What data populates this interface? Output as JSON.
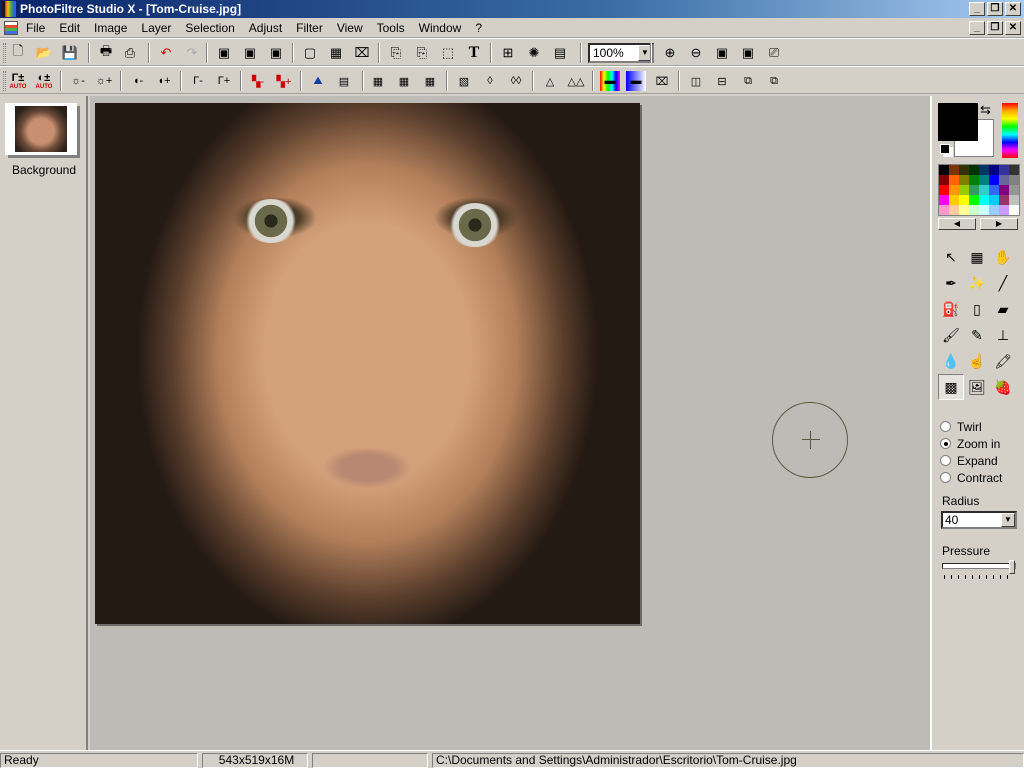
{
  "window": {
    "title": "PhotoFiltre Studio X - [Tom-Cruise.jpg]",
    "controls": {
      "minimize": "_",
      "restore": "❐",
      "close": "✕"
    }
  },
  "menu": [
    "File",
    "Edit",
    "Image",
    "Layer",
    "Selection",
    "Adjust",
    "Filter",
    "View",
    "Tools",
    "Window",
    "?"
  ],
  "toolbar1": {
    "icons": [
      "new-icon",
      "open-icon",
      "save-icon",
      "print-icon",
      "scan-icon",
      "undo-icon",
      "redo-icon",
      "copy-image-icon",
      "paste-image-icon",
      "paste-as-new-icon",
      "flatten-icon",
      "palette-icon",
      "transparency-icon",
      "export-icon",
      "crop-icon",
      "selection-icon",
      "text-icon",
      "explorer-icon",
      "plugins-icon",
      "window-icon",
      "zoom-in-icon",
      "zoom-out-icon",
      "fit-icon",
      "actual-size-icon",
      "slideshow-icon"
    ],
    "zoom_value": "100%",
    "glyphs": {
      "undo": "↶",
      "redo": "↷",
      "text": "T",
      "zoom_in": "⊕",
      "zoom_out": "⊖"
    }
  },
  "toolbar2": {
    "auto_label": "AUTO",
    "icons": [
      "gamma-auto-icon",
      "contrast-auto-icon",
      "brightness-minus-icon",
      "brightness-plus-icon",
      "contrast-minus-icon",
      "contrast-plus-icon",
      "gamma-minus-icon",
      "gamma-plus-icon",
      "saturation-minus-icon",
      "saturation-plus-icon",
      "histogram-icon",
      "color-balance-icon",
      "dust-filter-icon",
      "grid-filter-icon",
      "texture-filter-icon",
      "fade-icon",
      "blur-icon",
      "blur-more-icon",
      "sharpen-icon",
      "sharpen-more-icon",
      "gradient-icon",
      "gradient-fill-icon",
      "stamp-icon",
      "flip-horizontal-icon",
      "flip-vertical-icon",
      "rotate-left-icon",
      "rotate-right-icon"
    ]
  },
  "layers": [
    {
      "name": "Background"
    }
  ],
  "colors": {
    "foreground": "#000000",
    "background": "#ffffff",
    "palette": [
      "#000000",
      "#7f3300",
      "#333300",
      "#003300",
      "#003366",
      "#000080",
      "#333399",
      "#333333",
      "#800000",
      "#ff6600",
      "#808000",
      "#008000",
      "#008080",
      "#0000ff",
      "#666699",
      "#808080",
      "#ff0000",
      "#ff9900",
      "#99cc00",
      "#339966",
      "#33cccc",
      "#3366ff",
      "#800080",
      "#969696",
      "#ff00ff",
      "#ffcc00",
      "#ffff00",
      "#00ff00",
      "#00ffff",
      "#00ccff",
      "#993366",
      "#c0c0c0",
      "#ff99cc",
      "#ffcc99",
      "#ffff99",
      "#ccffcc",
      "#ccffff",
      "#99ccff",
      "#cc99ff",
      "#ffffff"
    ]
  },
  "tools": [
    {
      "name": "pointer-icon",
      "glyph": "↖"
    },
    {
      "name": "selection-tool-icon",
      "glyph": "▦"
    },
    {
      "name": "hand-icon",
      "glyph": "✋"
    },
    {
      "name": "eyedropper-icon",
      "glyph": "✒"
    },
    {
      "name": "magic-wand-icon",
      "glyph": "✨"
    },
    {
      "name": "line-icon",
      "glyph": "╱"
    },
    {
      "name": "fill-bucket-icon",
      "glyph": "⛽"
    },
    {
      "name": "spray-icon",
      "glyph": "▯"
    },
    {
      "name": "eraser-icon",
      "glyph": "▰"
    },
    {
      "name": "brush-icon",
      "glyph": "🖌"
    },
    {
      "name": "advanced-brush-icon",
      "glyph": "✎"
    },
    {
      "name": "clone-stamp-icon",
      "glyph": "⊥"
    },
    {
      "name": "blur-drop-icon",
      "glyph": "💧"
    },
    {
      "name": "smudge-finger-icon",
      "glyph": "☝"
    },
    {
      "name": "paint-roller-icon",
      "glyph": "🖍"
    },
    {
      "name": "deform-grid-icon",
      "glyph": "▩",
      "active": true
    },
    {
      "name": "portrait-icon",
      "glyph": "🖼"
    },
    {
      "name": "strawberry-icon",
      "glyph": "🍓"
    }
  ],
  "tool_options": {
    "modes": [
      {
        "label": "Twirl",
        "selected": false
      },
      {
        "label": "Zoom in",
        "selected": true
      },
      {
        "label": "Expand",
        "selected": false
      },
      {
        "label": "Contract",
        "selected": false
      }
    ],
    "radius_label": "Radius",
    "radius_value": "40",
    "pressure_label": "Pressure",
    "pressure_value": 1.0
  },
  "status": {
    "state": "Ready",
    "image_info": "543x519x16M",
    "extra": "",
    "path": "C:\\Documents and Settings\\Administrador\\Escritorio\\Tom-Cruise.jpg"
  }
}
